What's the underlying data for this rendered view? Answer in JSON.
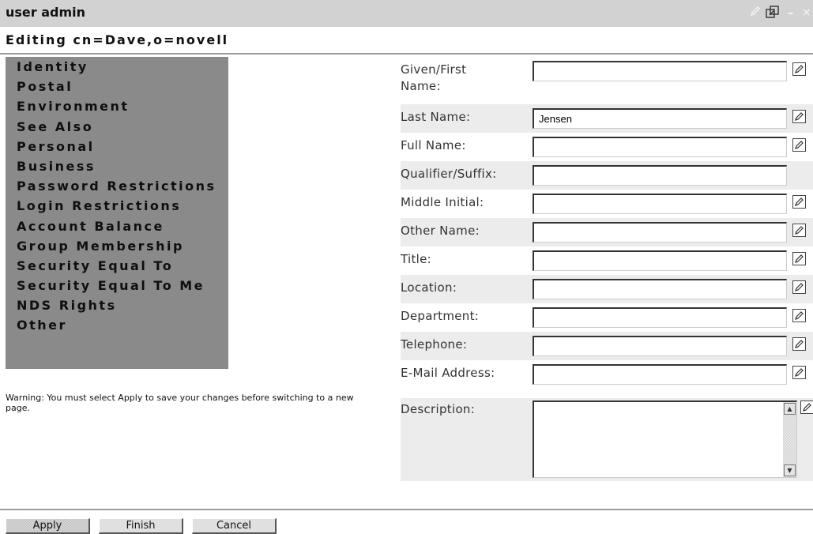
{
  "window": {
    "title": "user admin",
    "icons": [
      "edit-icon",
      "restore-icon",
      "minimize-icon",
      "close-icon"
    ]
  },
  "heading": "Editing cn=Dave,o=novell",
  "nav": {
    "items": [
      "Identity",
      "Postal",
      "Environment",
      "See Also",
      "Personal",
      "Business",
      "Password Restrictions",
      "Login Restrictions",
      "Account Balance",
      "Group Membership",
      "Security Equal To",
      "Security Equal To Me",
      "NDS Rights",
      "Other"
    ]
  },
  "warning": "Warning: You must select Apply to save your changes before switching to a new page.",
  "form": {
    "fields": [
      {
        "label": "Given/First Name:",
        "value": ""
      },
      {
        "label": "Last Name:",
        "value": "Jensen"
      },
      {
        "label": "Full Name:",
        "value": ""
      },
      {
        "label": "Qualifier/Suffix:",
        "value": ""
      },
      {
        "label": "Middle Initial:",
        "value": ""
      },
      {
        "label": "Other Name:",
        "value": ""
      },
      {
        "label": "Title:",
        "value": ""
      },
      {
        "label": "Location:",
        "value": ""
      },
      {
        "label": "Department:",
        "value": ""
      },
      {
        "label": "Telephone:",
        "value": ""
      },
      {
        "label": "E-Mail Address:",
        "value": ""
      }
    ],
    "description": {
      "label": "Description:",
      "value": ""
    }
  },
  "buttons": {
    "apply": "Apply",
    "finish": "Finish",
    "cancel": "Cancel"
  },
  "colors": {
    "nav_bg": "#8a8a8a",
    "titlebar_bg": "#d2d2d2",
    "row_shade": "#ececec"
  }
}
